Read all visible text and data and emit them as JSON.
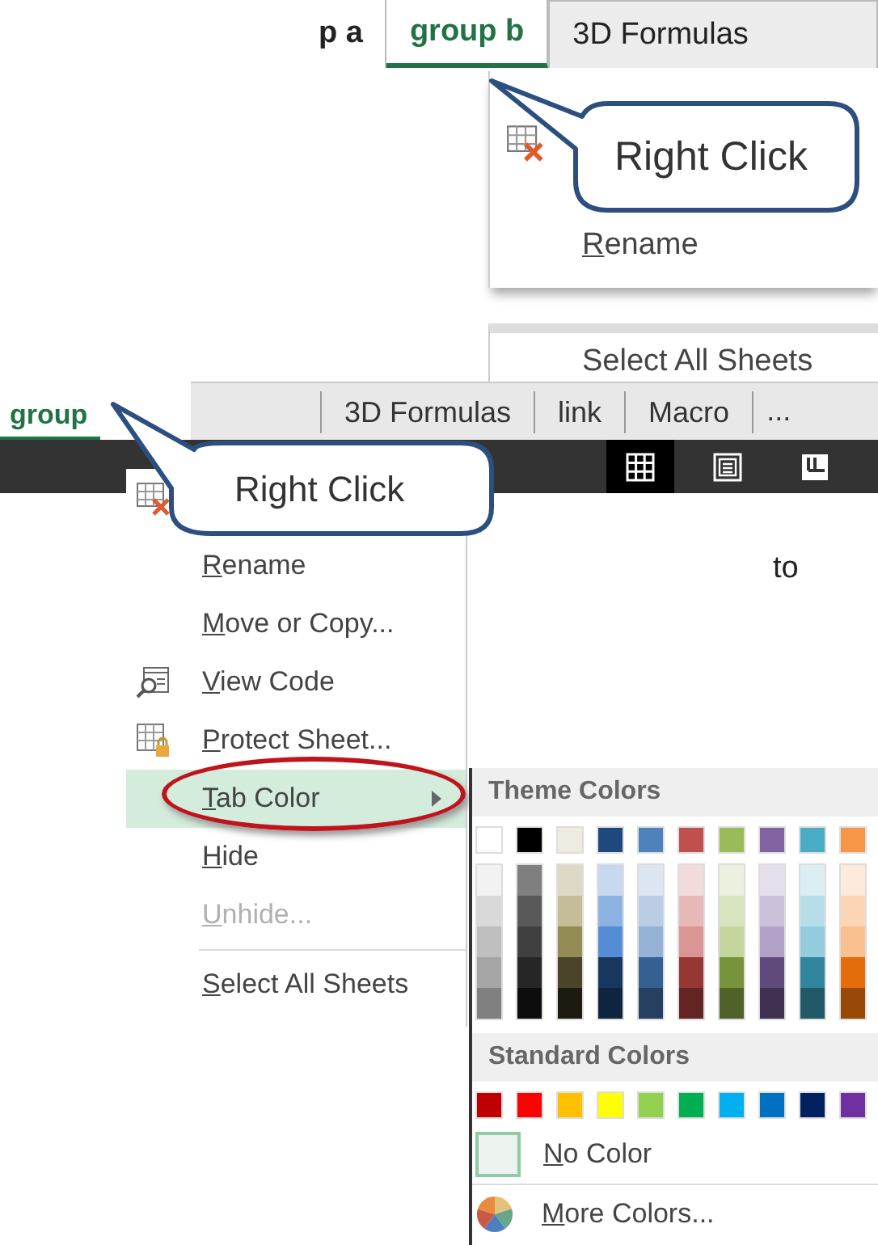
{
  "top_shot": {
    "tabs": [
      {
        "label": "p a",
        "selected": false
      },
      {
        "label": "group b",
        "selected": true
      },
      {
        "label": "3D Formulas",
        "selected": false
      }
    ],
    "menu": [
      {
        "kind": "delete"
      },
      {
        "kind": "text",
        "label": "Rename",
        "mnemonic": true
      }
    ],
    "menu_tail": {
      "label": "Select All Sheets"
    },
    "callout": "Right Click"
  },
  "bottom_shot": {
    "tabs": [
      {
        "label": "group",
        "selected": true
      },
      {
        "label": "3D Formulas",
        "selected": false
      },
      {
        "label": "link",
        "selected": false
      },
      {
        "label": "Macro",
        "selected": false
      }
    ],
    "more_tabs": "...",
    "view_buttons": [
      {
        "kind": "normal",
        "selected": true
      },
      {
        "kind": "page-layout",
        "selected": false
      },
      {
        "kind": "page-break",
        "selected": false
      }
    ],
    "context_menu": [
      {
        "kind": "delete",
        "disabled": false,
        "selected": false
      },
      {
        "kind": "text",
        "label": "Rename",
        "mnemonic": true,
        "disabled": false,
        "selected": false
      },
      {
        "kind": "text",
        "label": "Move or Copy...",
        "mnemonic": true,
        "disabled": false,
        "selected": false
      },
      {
        "kind": "code",
        "label": "View Code",
        "mnemonic": true,
        "disabled": false,
        "selected": false
      },
      {
        "kind": "protect",
        "label": "Protect Sheet...",
        "mnemonic": true,
        "disabled": false,
        "selected": false
      },
      {
        "kind": "submenu",
        "label": "Tab Color",
        "mnemonic": true,
        "disabled": false,
        "selected": true
      },
      {
        "kind": "text",
        "label": "Hide",
        "mnemonic": true,
        "disabled": false,
        "selected": false
      },
      {
        "kind": "text",
        "label": "Unhide...",
        "mnemonic": true,
        "disabled": true,
        "selected": false
      },
      {
        "kind": "separator"
      },
      {
        "kind": "text",
        "label": "Select All Sheets",
        "mnemonic": true,
        "disabled": false,
        "selected": false
      }
    ],
    "note": "to",
    "callout": "Right Click",
    "tab_color_menu": {
      "theme_title": "Theme Colors",
      "theme_colors": [
        {
          "color": "#ffffff",
          "shades": [
            {
              "color": "#f2f2f2"
            },
            {
              "color": "#d9d9d9"
            },
            {
              "color": "#bfbfbf"
            },
            {
              "color": "#a6a6a6"
            },
            {
              "color": "#808080"
            }
          ]
        },
        {
          "color": "#000000",
          "shades": [
            {
              "color": "#7f7f7f"
            },
            {
              "color": "#595959"
            },
            {
              "color": "#404040"
            },
            {
              "color": "#262626"
            },
            {
              "color": "#0d0d0d"
            }
          ]
        },
        {
          "color": "#eeece1",
          "shades": [
            {
              "color": "#ddd9c4"
            },
            {
              "color": "#c4bd97"
            },
            {
              "color": "#948a54"
            },
            {
              "color": "#4a452a"
            },
            {
              "color": "#1d1b10"
            }
          ]
        },
        {
          "color": "#1f497d",
          "shades": [
            {
              "color": "#c6d9f1"
            },
            {
              "color": "#8db3e2"
            },
            {
              "color": "#548dd4"
            },
            {
              "color": "#17375e"
            },
            {
              "color": "#0f243e"
            }
          ]
        },
        {
          "color": "#4f81bd",
          "shades": [
            {
              "color": "#dce6f2"
            },
            {
              "color": "#b9cde5"
            },
            {
              "color": "#95b3d7"
            },
            {
              "color": "#376092"
            },
            {
              "color": "#254061"
            }
          ]
        },
        {
          "color": "#c0504d",
          "shades": [
            {
              "color": "#f2dcdb"
            },
            {
              "color": "#e6b9b8"
            },
            {
              "color": "#d99694"
            },
            {
              "color": "#953735"
            },
            {
              "color": "#632523"
            }
          ]
        },
        {
          "color": "#9bbb59",
          "shades": [
            {
              "color": "#ebf1de"
            },
            {
              "color": "#d7e4bd"
            },
            {
              "color": "#c3d69b"
            },
            {
              "color": "#77933c"
            },
            {
              "color": "#4f6228"
            }
          ]
        },
        {
          "color": "#8064a2",
          "shades": [
            {
              "color": "#e6e0ec"
            },
            {
              "color": "#ccc1da"
            },
            {
              "color": "#b3a2c7"
            },
            {
              "color": "#604a7b"
            },
            {
              "color": "#403152"
            }
          ]
        },
        {
          "color": "#4bacc6",
          "shades": [
            {
              "color": "#dbeef4"
            },
            {
              "color": "#b7dee8"
            },
            {
              "color": "#93cddd"
            },
            {
              "color": "#31859c"
            },
            {
              "color": "#215968"
            }
          ]
        },
        {
          "color": "#f79646",
          "shades": [
            {
              "color": "#fdeada"
            },
            {
              "color": "#fcd5b5"
            },
            {
              "color": "#fac090"
            },
            {
              "color": "#e46c0a"
            },
            {
              "color": "#984807"
            }
          ]
        }
      ],
      "standard_title": "Standard Colors",
      "standard_colors": [
        {
          "color": "#c00000"
        },
        {
          "color": "#ff0000"
        },
        {
          "color": "#ffc000"
        },
        {
          "color": "#ffff00"
        },
        {
          "color": "#92d050"
        },
        {
          "color": "#00b050"
        },
        {
          "color": "#00b0f0"
        },
        {
          "color": "#0070c0"
        },
        {
          "color": "#002060"
        },
        {
          "color": "#7030a0"
        }
      ],
      "no_color": {
        "label": "No Color",
        "mnemonic": true
      },
      "more_colors": {
        "label": "More Colors...",
        "mnemonic": true
      }
    }
  }
}
